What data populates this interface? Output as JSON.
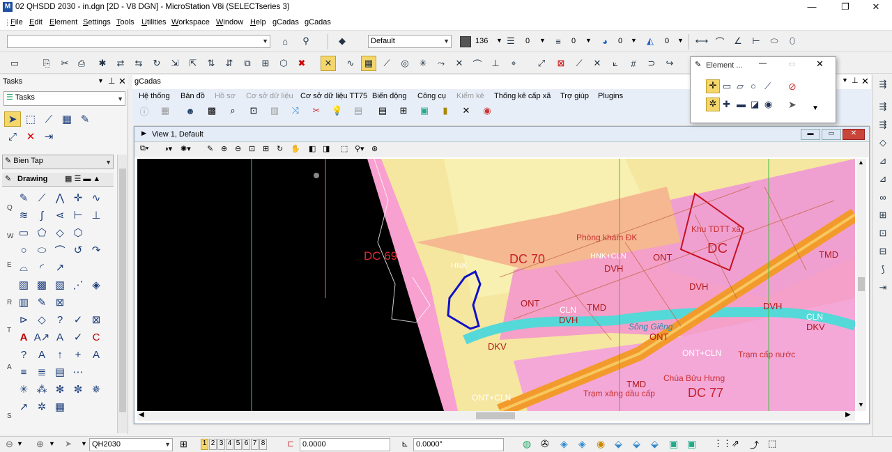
{
  "window": {
    "title": "02 QHSDD 2030 - in.dgn [2D - V8 DGN] - MicroStation V8i (SELECTseries 3)",
    "minimize": "—",
    "maximize": "❐",
    "close": "✕"
  },
  "menu": [
    "File",
    "Edit",
    "Element",
    "Settings",
    "Tools",
    "Utilities",
    "Workspace",
    "Window",
    "Help",
    "gCadas",
    "gCadas"
  ],
  "toolbar1": {
    "level": "Default",
    "color": "136",
    "style": "0",
    "weight": "0",
    "transp": "0",
    "priority": "0"
  },
  "tasks": {
    "header": "Tasks",
    "dropdown": "Tasks",
    "bien_tap": "Bien Tap",
    "drawing": "Drawing",
    "groups": [
      "Q",
      "W",
      "E",
      "R",
      "T",
      "A",
      "S"
    ]
  },
  "gcadas": {
    "title": "gCadas",
    "menu": [
      "Hệ thống",
      "Bản đồ",
      "Hồ sơ",
      "Cơ sở dữ liệu",
      "Cơ sở dữ liệu TT75",
      "Biến động",
      "Công cụ",
      "Kiểm kê",
      "Thống kê cấp xã",
      "Trợ giúp",
      "Plugins"
    ],
    "disabled": [
      2,
      3,
      7
    ]
  },
  "view": {
    "title": "View 1, Default"
  },
  "element_dialog": {
    "title": "Element ..."
  },
  "map_labels": [
    {
      "t": "DC 69",
      "c": "#e0282c",
      "s": 17
    },
    {
      "t": "DC 70",
      "c": "#c8202c",
      "s": 18
    },
    {
      "t": "DC",
      "c": "#c8202c",
      "s": 20
    },
    {
      "t": "DC 77",
      "c": "#c8202c",
      "s": 18
    },
    {
      "t": "ONT",
      "c": "#b01818",
      "s": 13
    },
    {
      "t": "ONT",
      "c": "#b01818",
      "s": 13
    },
    {
      "t": "ONT",
      "c": "#b01818",
      "s": 13
    },
    {
      "t": "DVH",
      "c": "#b01818",
      "s": 13
    },
    {
      "t": "DVH",
      "c": "#b01818",
      "s": 13
    },
    {
      "t": "DVH",
      "c": "#b01818",
      "s": 13
    },
    {
      "t": "DVH",
      "c": "#b01818",
      "s": 13
    },
    {
      "t": "TMD",
      "c": "#b01818",
      "s": 13
    },
    {
      "t": "TMD",
      "c": "#b01818",
      "s": 13
    },
    {
      "t": "TMD",
      "c": "#b01818",
      "s": 13
    },
    {
      "t": "DKV",
      "c": "#b01818",
      "s": 13
    },
    {
      "t": "DKV",
      "c": "#b01818",
      "s": 13
    },
    {
      "t": "CLN",
      "c": "#fff",
      "s": 12
    },
    {
      "t": "CLN",
      "c": "#fff",
      "s": 12
    },
    {
      "t": "Phòng khám ĐK",
      "c": "#c83030",
      "s": 12
    },
    {
      "t": "Khu TDTT xã",
      "c": "#c83030",
      "s": 12
    },
    {
      "t": "Trạm cấp nước",
      "c": "#c83030",
      "s": 12
    },
    {
      "t": "Chùa Bửu Hưng",
      "c": "#c83030",
      "s": 12
    },
    {
      "t": "Trạm xăng dầu cấp",
      "c": "#c83030",
      "s": 12
    },
    {
      "t": "Sông Giêng",
      "c": "#2a8ab0",
      "s": 12
    },
    {
      "t": "HNK",
      "c": "#fff",
      "s": 11
    },
    {
      "t": "ONT+CLN",
      "c": "#fff",
      "s": 12
    },
    {
      "t": "ONT+CLN",
      "c": "#fff",
      "s": 12
    },
    {
      "t": "HNK+CLN",
      "c": "#fff",
      "s": 11
    }
  ],
  "status": {
    "model": "QH2030",
    "views": [
      "1",
      "2",
      "3",
      "4",
      "5",
      "6",
      "7",
      "8"
    ],
    "x": "0.0000",
    "angle": "0.0000°"
  }
}
